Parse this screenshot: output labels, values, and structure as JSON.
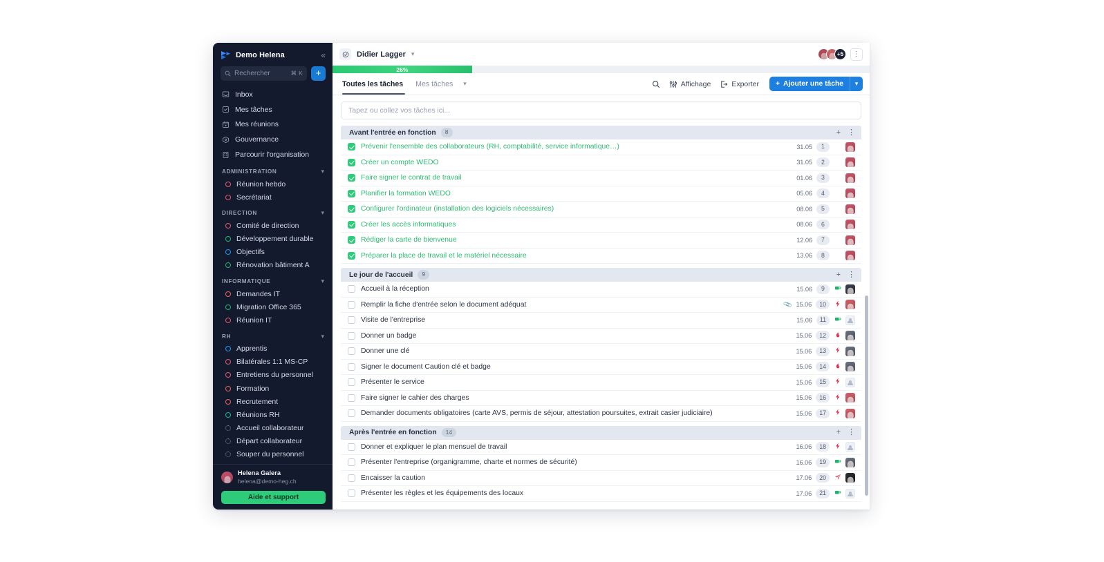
{
  "sidebar": {
    "workspace": "Demo Helena",
    "collapse_icon": "chevron-double-left-icon",
    "search": {
      "placeholder": "Rechercher",
      "shortcut": "⌘ K"
    },
    "add_label": "+",
    "nav": [
      {
        "label": "Inbox",
        "icon": "inbox-icon"
      },
      {
        "label": "Mes tâches",
        "icon": "check-square-icon"
      },
      {
        "label": "Mes réunions",
        "icon": "calendar-icon"
      },
      {
        "label": "Gouvernance",
        "icon": "governance-icon"
      },
      {
        "label": "Parcourir l'organisation",
        "icon": "building-icon"
      }
    ],
    "groups": [
      {
        "title": "ADMINISTRATION",
        "items": [
          {
            "label": "Réunion hebdo",
            "color": "#e05a6e"
          },
          {
            "label": "Secrétariat",
            "color": "#e05a6e"
          }
        ]
      },
      {
        "title": "DIRECTION",
        "items": [
          {
            "label": "Comité de direction",
            "color": "#e05a6e"
          },
          {
            "label": "Développement durable",
            "color": "#22b06e"
          },
          {
            "label": "Objectifs",
            "color": "#2196f3"
          },
          {
            "label": "Rénovation bâtiment A",
            "color": "#22b06e"
          }
        ]
      },
      {
        "title": "INFORMATIQUE",
        "items": [
          {
            "label": "Demandes IT",
            "color": "#e0675a"
          },
          {
            "label": "Migration Office 365",
            "color": "#22b06e"
          },
          {
            "label": "Réunion IT",
            "color": "#e05a6e"
          }
        ]
      },
      {
        "title": "RH",
        "items": [
          {
            "label": "Apprentis",
            "color": "#2196f3"
          },
          {
            "label": "Bilatérales 1:1 MS-CP",
            "color": "#e05a6e"
          },
          {
            "label": "Entretiens du personnel",
            "color": "#e05a6e"
          },
          {
            "label": "Formation",
            "color": "#e0675a"
          },
          {
            "label": "Recrutement",
            "color": "#e0675a"
          },
          {
            "label": "Réunions RH",
            "color": "#10b5a0"
          },
          {
            "label": "Accueil collaborateur",
            "color": "#7d869c",
            "dotted": true
          },
          {
            "label": "Départ collaborateur",
            "color": "#7d869c",
            "dotted": true
          },
          {
            "label": "Souper du personnel",
            "color": "#7d869c",
            "dotted": true
          }
        ]
      }
    ],
    "user": {
      "name": "Helena Galera",
      "email": "helena@demo-heg.ch"
    },
    "help_button": "Aide et support"
  },
  "header": {
    "breadcrumb_icon": "target-check-icon",
    "breadcrumb": "Didier Lagger",
    "breadcrumb_chevron": "chevron-down-icon",
    "avatars_more": "+5",
    "kebab_icon": "kebab-menu-icon"
  },
  "progress": {
    "percent_label": "26%",
    "percent": 26,
    "color": "#2ec971"
  },
  "toolbar": {
    "tabs": [
      {
        "label": "Toutes les tâches",
        "active": true
      },
      {
        "label": "Mes tâches",
        "active": false
      }
    ],
    "tabs_chevron": "chevron-down-icon",
    "search_icon": "search-icon",
    "view_label": "Affichage",
    "view_icon": "sliders-icon",
    "export_label": "Exporter",
    "export_icon": "export-icon",
    "add_task_label": "Ajouter une tâche",
    "add_task_plus": "+",
    "add_task_caret": "chevron-down-icon"
  },
  "quick_add": {
    "placeholder": "Tapez ou collez vos tâches ici..."
  },
  "sections": [
    {
      "title": "Avant l'entrée en fonction",
      "count": "8",
      "add_icon": "plus-icon",
      "menu_icon": "kebab-menu-icon",
      "tasks": [
        {
          "title": "Prévenir l'ensemble des collaborateurs (RH, comptabilité, service informatique…)",
          "done": true,
          "date": "31.05",
          "num": "1",
          "prio": "",
          "avatar": "c-red",
          "clip": false
        },
        {
          "title": "Créer un compte WEDO",
          "done": true,
          "date": "31.05",
          "num": "2",
          "prio": "",
          "avatar": "c-red",
          "clip": false
        },
        {
          "title": "Faire signer le contrat de travail",
          "done": true,
          "date": "01.06",
          "num": "3",
          "prio": "",
          "avatar": "c-red",
          "clip": false
        },
        {
          "title": "Planifier la formation WEDO",
          "done": true,
          "date": "05.06",
          "num": "4",
          "prio": "",
          "avatar": "c-red",
          "clip": false
        },
        {
          "title": "Configurer l'ordinateur (installation des logiciels nécessaires)",
          "done": true,
          "date": "08.06",
          "num": "5",
          "prio": "",
          "avatar": "c-red",
          "clip": false
        },
        {
          "title": "Créer les accès informatiques",
          "done": true,
          "date": "08.06",
          "num": "6",
          "prio": "",
          "avatar": "c-red",
          "clip": false
        },
        {
          "title": "Rédiger la carte de bienvenue",
          "done": true,
          "date": "12.06",
          "num": "7",
          "prio": "",
          "avatar": "c-red",
          "clip": false
        },
        {
          "title": "Préparer la place de travail et le matériel nécessaire",
          "done": true,
          "date": "13.06",
          "num": "8",
          "prio": "",
          "avatar": "c-red",
          "clip": false
        }
      ]
    },
    {
      "title": "Le jour de l'accueil",
      "count": "9",
      "add_icon": "plus-icon",
      "menu_icon": "kebab-menu-icon",
      "tasks": [
        {
          "title": "Accueil à la réception",
          "done": false,
          "date": "15.06",
          "num": "9",
          "prio": "coffee",
          "avatar": "c-dark",
          "clip": false
        },
        {
          "title": "Remplir la fiche d'entrée selon le document adéquat",
          "done": false,
          "date": "15.06",
          "num": "10",
          "prio": "bolt",
          "avatar": "c-warm",
          "clip": true
        },
        {
          "title": "Visite de l'entreprise",
          "done": false,
          "date": "15.06",
          "num": "11",
          "prio": "coffee",
          "avatar": "empty",
          "clip": false
        },
        {
          "title": "Donner un badge",
          "done": false,
          "date": "15.06",
          "num": "12",
          "prio": "flame",
          "avatar": "c-gray",
          "clip": false
        },
        {
          "title": "Donner une clé",
          "done": false,
          "date": "15.06",
          "num": "13",
          "prio": "bolt",
          "avatar": "c-gray",
          "clip": false
        },
        {
          "title": "Signer le document Caution clé et badge",
          "done": false,
          "date": "15.06",
          "num": "14",
          "prio": "flame",
          "avatar": "c-gray",
          "clip": false
        },
        {
          "title": "Présenter le service",
          "done": false,
          "date": "15.06",
          "num": "15",
          "prio": "bolt",
          "avatar": "empty",
          "clip": false
        },
        {
          "title": "Faire signer le cahier des charges",
          "done": false,
          "date": "15.06",
          "num": "16",
          "prio": "bolt",
          "avatar": "c-warm",
          "clip": false
        },
        {
          "title": "Demander documents obligatoires (carte AVS, permis de séjour, attestation poursuites, extrait casier judiciaire)",
          "done": false,
          "date": "15.06",
          "num": "17",
          "prio": "bolt",
          "avatar": "c-warm",
          "clip": false
        }
      ]
    },
    {
      "title": "Après l'entrée en fonction",
      "count": "14",
      "add_icon": "plus-icon",
      "menu_icon": "kebab-menu-icon",
      "tasks": [
        {
          "title": "Donner et expliquer le plan mensuel de travail",
          "done": false,
          "date": "16.06",
          "num": "18",
          "prio": "bolt",
          "avatar": "empty",
          "clip": false
        },
        {
          "title": "Présenter l'entreprise (organigramme, charte et normes de sécurité)",
          "done": false,
          "date": "16.06",
          "num": "19",
          "prio": "coffee",
          "avatar": "c-gray",
          "clip": false
        },
        {
          "title": "Encaisser la caution",
          "done": false,
          "date": "17.06",
          "num": "20",
          "prio": "plane",
          "avatar": "c-black",
          "clip": false
        },
        {
          "title": "Présenter les règles et les équipements des locaux",
          "done": false,
          "date": "17.06",
          "num": "21",
          "prio": "coffee",
          "avatar": "empty",
          "clip": false
        }
      ]
    }
  ]
}
